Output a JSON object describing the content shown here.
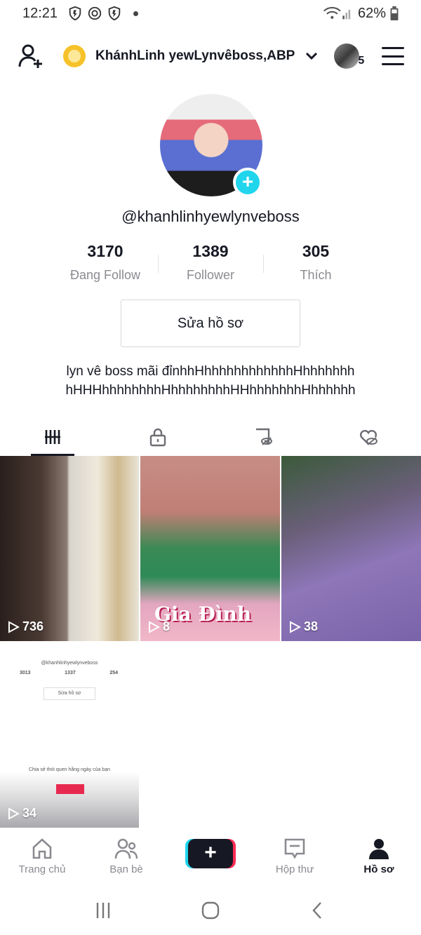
{
  "status": {
    "time": "12:21",
    "battery": "62%"
  },
  "header": {
    "account_name": "KhánhLinh yewLynvêboss,ABP",
    "friend_count": "5"
  },
  "profile": {
    "handle": "@khanhlinhyewlynveboss",
    "stats": [
      {
        "value": "3170",
        "label": "Đang Follow"
      },
      {
        "value": "1389",
        "label": "Follower"
      },
      {
        "value": "305",
        "label": "Thích"
      }
    ],
    "edit_label": "Sửa hồ sơ",
    "bio_line1": "lyn vê boss mãi đỉnhhHhhhhhhhhhhhhHhhhhhhh",
    "bio_line2": "hHHHhhhhhhhhHhhhhhhhhHHhhhhhhhHhhhhhh"
  },
  "tabs": [
    "videos-icon",
    "lock-icon",
    "saved-hidden-icon",
    "liked-hidden-icon"
  ],
  "videos": [
    {
      "views": "736"
    },
    {
      "views": "8",
      "caption": "Gia Đình"
    },
    {
      "views": "38"
    },
    {
      "views": "34",
      "mini": {
        "handle": "@khanhlinhyewlynveboss",
        "stats": [
          "3013",
          "1337",
          "254"
        ],
        "edit": "Sửa hồ sơ",
        "share": "Chia sẻ thói quen hằng ngày của bạn"
      }
    }
  ],
  "bottom_nav": [
    {
      "label": "Trang chủ",
      "icon": "home-icon"
    },
    {
      "label": "Bạn bè",
      "icon": "friends-icon"
    },
    {
      "label": "",
      "icon": "create-plus-icon"
    },
    {
      "label": "Hộp thư",
      "icon": "inbox-icon"
    },
    {
      "label": "Hồ sơ",
      "icon": "profile-icon"
    }
  ],
  "colors": {
    "accent_cyan": "#20d5ec",
    "accent_red": "#fe2c55",
    "text": "#161823",
    "muted": "#8a8b91"
  }
}
